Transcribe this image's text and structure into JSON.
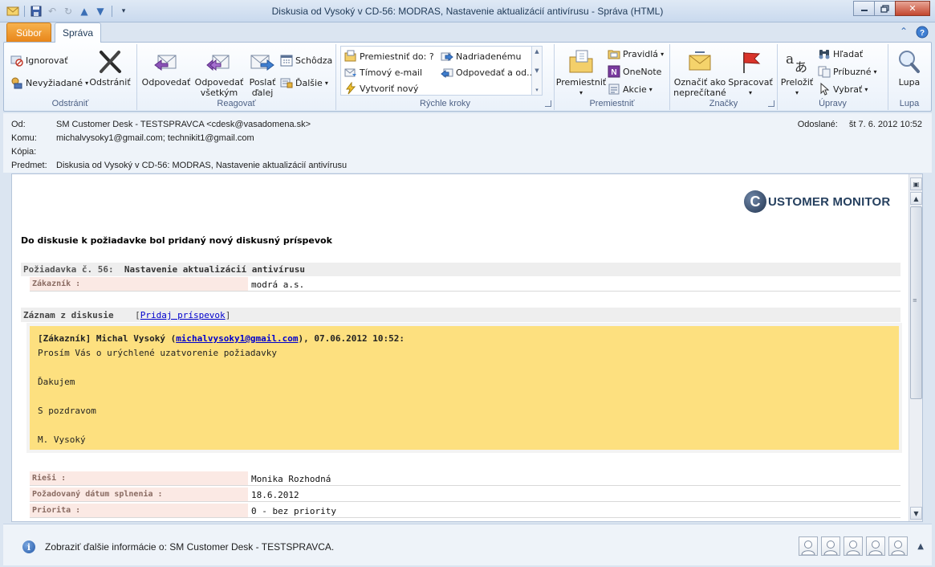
{
  "window": {
    "title": "Diskusia od Vysoký v CD-56: MODRAS, Nastavenie  aktualizácií antivírusu  -  Správa (HTML)"
  },
  "tabs": {
    "file": "Súbor",
    "home": "Správa"
  },
  "ribbon": {
    "delete_group": {
      "label": "Odstrániť",
      "ignore": "Ignorovať",
      "junk": "Nevyžiadané",
      "delete": "Odstrániť"
    },
    "respond_group": {
      "label": "Reagovať",
      "reply": "Odpovedať",
      "reply_all_1": "Odpovedať",
      "reply_all_2": "všetkým",
      "forward_1": "Poslať",
      "forward_2": "ďalej",
      "meeting": "Schôdza",
      "more": "Ďalšie"
    },
    "quick_steps": {
      "label": "Rýchle kroky",
      "items": [
        "Premiestniť do: ?",
        "Nadriadenému",
        "Tímový e-mail",
        "Odpovedať a od...",
        "Vytvoriť nový"
      ]
    },
    "move_group": {
      "label": "Premiestniť",
      "move": "Premiestniť",
      "rules": "Pravidlá",
      "onenote": "OneNote",
      "actions": "Akcie"
    },
    "tags_group": {
      "label": "Značky",
      "mark_unread_1": "Označiť ako",
      "mark_unread_2": "neprečítané",
      "followup": "Spracovať"
    },
    "editing_group": {
      "label": "Úpravy",
      "translate": "Preložiť",
      "find": "Hľadať",
      "related": "Príbuzné",
      "select": "Vybrať"
    },
    "zoom_group": {
      "label": "Lupa",
      "zoom": "Lupa"
    }
  },
  "header": {
    "from_label": "Od:",
    "from_value": "SM Customer Desk  - TESTSPRAVCA <cdesk@vasadomena.sk>",
    "to_label": "Komu:",
    "to_value": "michalvysoky1@gmail.com; technikit1@gmail.com",
    "cc_label": "Kópia:",
    "cc_value": "",
    "subject_label": "Predmet:",
    "subject_value": "Diskusia od Vysoký v CD-56: MODRAS, Nastavenie  aktualizácií antivírusu",
    "sent_label": "Odoslané:",
    "sent_value": "št 7. 6. 2012 10:52"
  },
  "message": {
    "logo_letter": "C",
    "logo_text": "USTOMER MONITOR",
    "heading": "Do diskusie k požiadavke bol pridaný nový diskusný príspevok",
    "request_label": "Požiadavka č. 56:",
    "request_title": "Nastavenie aktualizácií antivírusu",
    "customer_label": "Zákazník :",
    "customer_value": "modrá a.s.",
    "discussion_label": "Záznam z diskusie",
    "add_post_link": "Pridaj príspevok",
    "post_author_prefix": "[Zákazník] Michal Vysoký (",
    "post_author_email": "michalvysoky1@gmail.com",
    "post_author_suffix": "), 07.06.2012 10:52:",
    "post_lines": [
      "Prosím Vás o urýchlené uzatvorenie požiadavky",
      "",
      "Ďakujem",
      "",
      "S pozdravom",
      "",
      "M. Vysoký"
    ],
    "fields": [
      {
        "label": "Rieši :",
        "value": "Monika Rozhodná"
      },
      {
        "label": "Požadovaný dátum splnenia :",
        "value": "18.6.2012"
      },
      {
        "label": "Priorita :",
        "value": "0 - bez priority"
      }
    ]
  },
  "people_bar": {
    "info_text": "Zobraziť ďalšie informácie o: SM Customer Desk  - TESTSPRAVCA."
  },
  "colors": {
    "file_tab": "#e8861a",
    "post_background": "#fde07f",
    "field_label_background": "#fbe9e4",
    "link": "#0000cc"
  }
}
